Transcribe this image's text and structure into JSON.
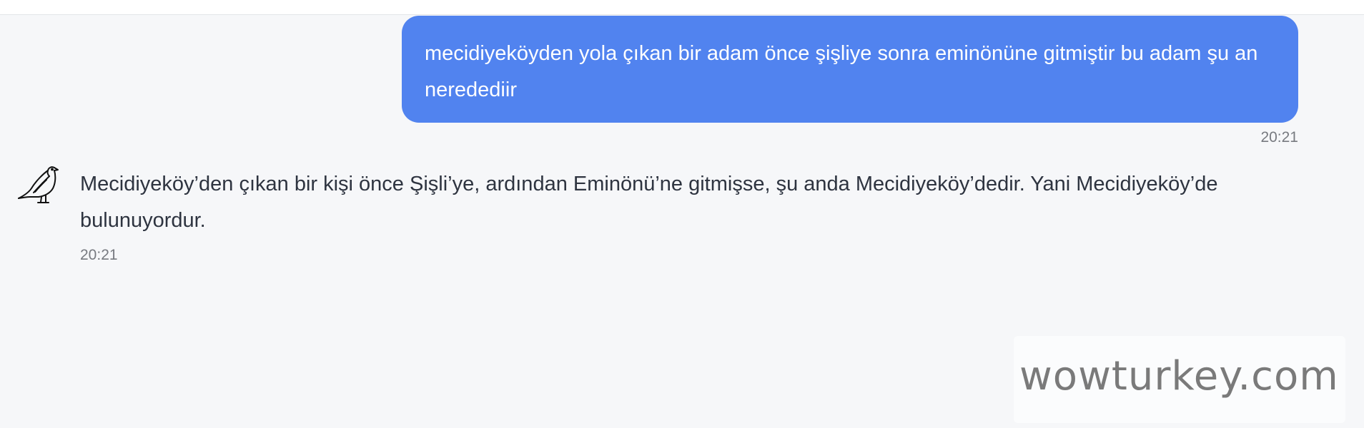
{
  "conversation": {
    "user_message": {
      "text": "mecidiyeköyden yola çıkan bir adam önce şişliye sonra eminönüne gitmiştir bu adam şu an neredediir",
      "time": "20:21"
    },
    "bot_message": {
      "text": "Mecidiyeköy’den çıkan bir kişi önce Şişli’ye, ardından Eminönü’ne gitmişse, şu anda Mecidiyeköy’dedir. Yani Mecidiyeköy’de bulunuyordur.",
      "time": "20:21",
      "avatar_icon": "dove-icon"
    }
  },
  "watermark": {
    "text": "wowturkey.com"
  },
  "colors": {
    "user_bubble": "#5183ef",
    "background": "#f6f7f9",
    "text": "#2e3440",
    "timestamp": "#777a80"
  }
}
